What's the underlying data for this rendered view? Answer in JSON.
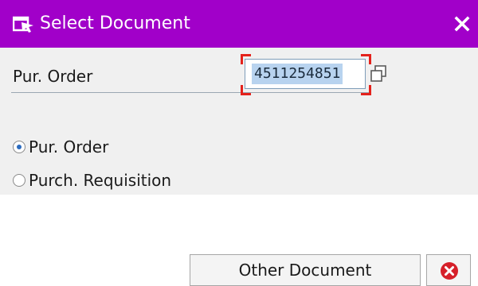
{
  "dialog": {
    "title": "Select Document",
    "title_icon": "select-document-icon",
    "close_icon": "close-icon",
    "accent_color": "#a100c9"
  },
  "field": {
    "label": "Pur. Order",
    "value": "4511254851",
    "value_help_icon": "value-help-icon"
  },
  "options": [
    {
      "label": "Pur. Order",
      "selected": true
    },
    {
      "label": "Purch. Requisition",
      "selected": false
    }
  ],
  "buttons": {
    "other_document": "Other Document",
    "cancel_icon": "cancel-icon"
  }
}
